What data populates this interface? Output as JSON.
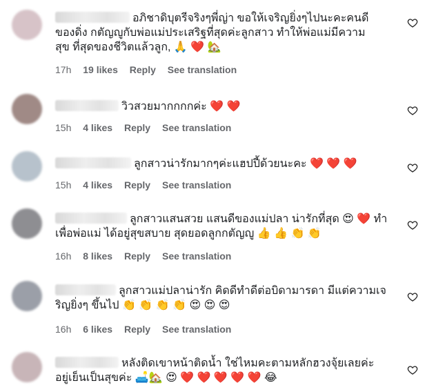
{
  "comments": [
    {
      "text_lines": [
        "อภิชาดิบุตรีจริงๆพี่ญ่า ขอให้เจริญยิ่งๆไปนะคะคนดี",
        "ของดิ่ง กตัญญูกับพ่อแม่ประเสริฐที่สุดค่ะลูกสาว ทำให้พ่อแม่มีความ",
        "สุข ที่สุดของชีวิตแล้วลูก, 🙏 ❤️ 🏡"
      ],
      "time": "17h",
      "likes": "19 likes",
      "reply": "Reply",
      "translation": "See translation",
      "avatar_color": "#d7c3c8"
    },
    {
      "text_lines": [
        "วิวสวยมากกกกค่ะ ❤️ ❤️"
      ],
      "time": "15h",
      "likes": "4 likes",
      "reply": "Reply",
      "translation": "See translation",
      "avatar_color": "#a08a86"
    },
    {
      "text_lines": [
        "ลูกสาวน่ารักมากๆค่ะแฮปปี้ด้วยนะคะ ❤️ ❤️ ❤️"
      ],
      "time": "15h",
      "likes": "4 likes",
      "reply": "Reply",
      "translation": "See translation",
      "avatar_color": "#b7c2cc"
    },
    {
      "text_lines": [
        "ลูกสาวแสนสวย แสนดีของแม่ปลา น่ารักที่สุด 😍 ❤️ ทำ",
        "เพื่อพ่อแม่ ได้อยู่สุขสบาย สุดยอดลูกกตัญญู 👍 👍 👏 👏"
      ],
      "time": "16h",
      "likes": "8 likes",
      "reply": "Reply",
      "translation": "See translation",
      "avatar_color": "#8e8e92"
    },
    {
      "text_lines": [
        "ลูกสาวแม่ปลาน่ารัก คิดดีทำดีต่อบิดามารดา มีแต่ความเจ",
        "ริญยิ่งๆ ขึ้นไป 👏 👏 👏 👏 😍 😍 😍"
      ],
      "time": "16h",
      "likes": "6 likes",
      "reply": "Reply",
      "translation": "See translation",
      "avatar_color": "#9b9fa8"
    },
    {
      "text_lines": [
        "หลังติดเขาหน้าติดน้ำ ใช่ไหมคะตามหลักฮวงจุ้ยเลยค่ะ",
        "อยู่เย็นเป็นสุขค่ะ 🛋️🏡 😍 ❤️ ❤️ ❤️ ❤️ ❤️ 😂"
      ],
      "time": "",
      "likes": "",
      "reply": "",
      "translation": "",
      "avatar_color": "#c8b5b8"
    }
  ]
}
